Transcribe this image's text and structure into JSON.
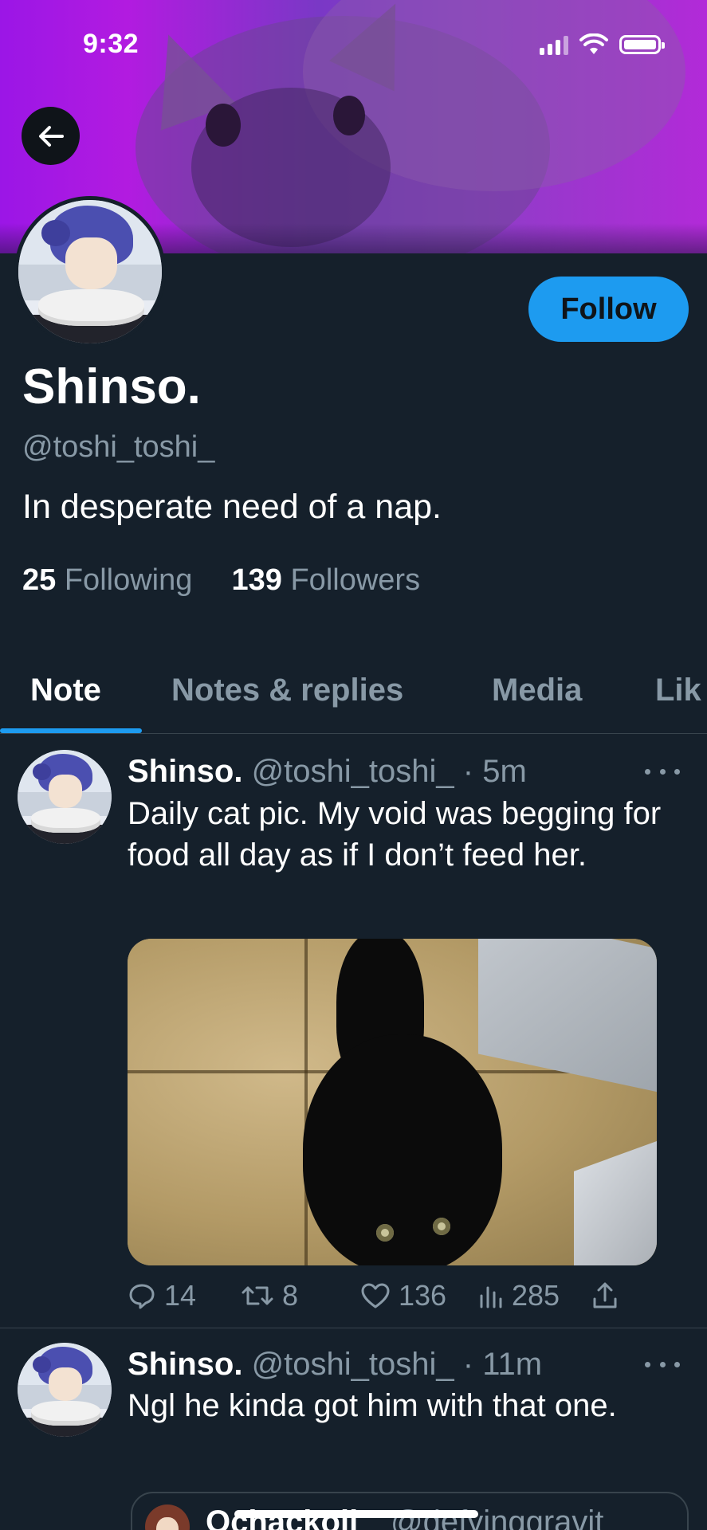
{
  "status_bar": {
    "time": "9:32"
  },
  "profile": {
    "display_name": "Shinso.",
    "handle": "@toshi_toshi_",
    "bio": "In desperate need of a nap.",
    "following_count": "25",
    "following_label": "Following",
    "followers_count": "139",
    "followers_label": "Followers",
    "follow_button": "Follow"
  },
  "tabs": [
    {
      "label": "Note",
      "active": true
    },
    {
      "label": "Notes & replies",
      "active": false
    },
    {
      "label": "Media",
      "active": false
    },
    {
      "label": "Lik",
      "active": false
    }
  ],
  "posts": [
    {
      "name": "Shinso.",
      "meta": "@toshi_toshi_ · 5m",
      "text": "Daily cat pic. My void was begging for food all day as if I don’t feed her.",
      "replies": "14",
      "retweets": "8",
      "likes": "136",
      "views": "285"
    },
    {
      "name": "Shinso.",
      "meta": "@toshi_toshi_ · 11m",
      "text": "Ngl he kinda got him with that one.",
      "quote": {
        "name": "Ochackoll",
        "handle": "@defyinggravit"
      }
    }
  ],
  "colors": {
    "background": "#15202B",
    "accent": "#1d9bf0",
    "secondary_text": "#8899a6",
    "divider": "#38444d"
  },
  "icons": {
    "back": "arrow-left-icon",
    "more": "more-horizontal-icon",
    "reply": "reply-icon",
    "retweet": "retweet-icon",
    "like": "heart-icon",
    "views": "views-icon",
    "share": "share-icon"
  }
}
